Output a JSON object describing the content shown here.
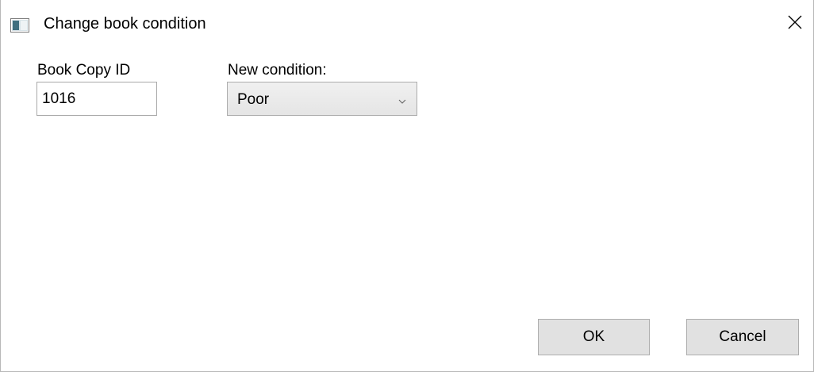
{
  "window": {
    "title": "Change book condition"
  },
  "form": {
    "book_copy_id_label": "Book Copy ID",
    "book_copy_id_value": "1016",
    "new_condition_label": "New condition:",
    "new_condition_value": "Poor"
  },
  "buttons": {
    "ok_label": "OK",
    "cancel_label": "Cancel"
  },
  "icons": {
    "app": "window-app-icon",
    "close": "close-icon",
    "dropdown": "chevron-down-icon"
  }
}
